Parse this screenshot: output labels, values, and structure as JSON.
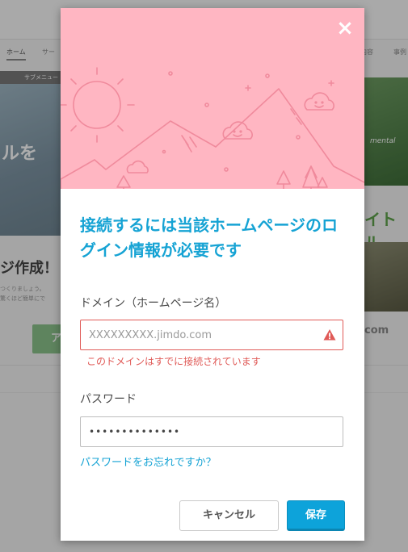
{
  "background": {
    "nav_home": "ホーム",
    "nav_services": "サー",
    "nav_right_1": "内容",
    "nav_right_2": "事例",
    "submenu": "サブメニュー",
    "hero_left_text": "ルを",
    "left_title": "ジ作成！",
    "left_sub": "つくりましょう。\n驚くほど簡単にで",
    "left_button": "ア",
    "right_hero_text": "mental",
    "right_title": "イトル",
    "right_com": "com"
  },
  "modal": {
    "close_label": "×",
    "title": "接続するには当該ホームページのログイン情報が必要です",
    "domain_label": "ドメイン（ホームページ名）",
    "domain_value": "",
    "domain_placeholder": "XXXXXXXXX.jimdo.com",
    "domain_error": "このドメインはすでに接続されています",
    "password_label": "パスワード",
    "password_value": "••••••••••••••",
    "forgot_link": "パスワードをお忘れですか？",
    "cancel_button": "キャンセル",
    "save_button": "保存"
  },
  "colors": {
    "hero_pink": "#ffb6c2",
    "accent_blue": "#16a3d4",
    "error_red": "#e05a57"
  }
}
